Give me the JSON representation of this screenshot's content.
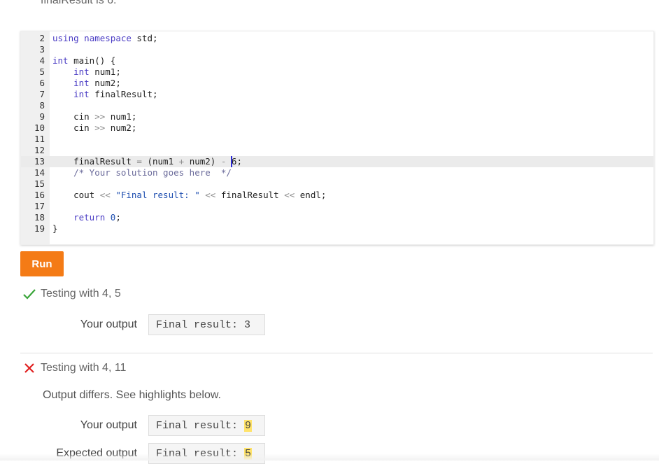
{
  "top_cut_text": "finalResult is 6.",
  "editor": {
    "lines": [
      {
        "n": "2",
        "parts": [
          [
            "kw",
            "using"
          ],
          [
            "t",
            " "
          ],
          [
            "kw",
            "namespace"
          ],
          [
            "t",
            " std;"
          ]
        ]
      },
      {
        "n": "3",
        "parts": []
      },
      {
        "n": "4",
        "parts": [
          [
            "kw",
            "int"
          ],
          [
            "t",
            " main() {"
          ]
        ]
      },
      {
        "n": "5",
        "parts": [
          [
            "t",
            "    "
          ],
          [
            "kw",
            "int"
          ],
          [
            "t",
            " num1;"
          ]
        ]
      },
      {
        "n": "6",
        "parts": [
          [
            "t",
            "    "
          ],
          [
            "kw",
            "int"
          ],
          [
            "t",
            " num2;"
          ]
        ]
      },
      {
        "n": "7",
        "parts": [
          [
            "t",
            "    "
          ],
          [
            "kw",
            "int"
          ],
          [
            "t",
            " finalResult;"
          ]
        ]
      },
      {
        "n": "8",
        "parts": []
      },
      {
        "n": "9",
        "parts": [
          [
            "t",
            "    cin "
          ],
          [
            "op",
            ">>"
          ],
          [
            "t",
            " num1;"
          ]
        ]
      },
      {
        "n": "10",
        "parts": [
          [
            "t",
            "    cin "
          ],
          [
            "op",
            ">>"
          ],
          [
            "t",
            " num2;"
          ]
        ]
      },
      {
        "n": "11",
        "parts": []
      },
      {
        "n": "12",
        "parts": []
      },
      {
        "n": "13",
        "active": true,
        "parts": [
          [
            "t",
            "    finalResult "
          ],
          [
            "op",
            "="
          ],
          [
            "t",
            " (num1 "
          ],
          [
            "op",
            "+"
          ],
          [
            "t",
            " num2) "
          ],
          [
            "op",
            "-"
          ],
          [
            "t",
            " "
          ],
          [
            "cur",
            "6"
          ],
          [
            "t",
            ";"
          ]
        ]
      },
      {
        "n": "14",
        "parts": [
          [
            "t",
            "    "
          ],
          [
            "cmt",
            "/* Your solution goes here  */"
          ]
        ]
      },
      {
        "n": "15",
        "parts": []
      },
      {
        "n": "16",
        "parts": [
          [
            "t",
            "    cout "
          ],
          [
            "op",
            "<<"
          ],
          [
            "t",
            " "
          ],
          [
            "str",
            "\"Final result: \""
          ],
          [
            "t",
            " "
          ],
          [
            "op",
            "<<"
          ],
          [
            "t",
            " finalResult "
          ],
          [
            "op",
            "<<"
          ],
          [
            "t",
            " endl;"
          ]
        ]
      },
      {
        "n": "17",
        "parts": []
      },
      {
        "n": "18",
        "parts": [
          [
            "t",
            "    "
          ],
          [
            "kw",
            "return"
          ],
          [
            "t",
            " "
          ],
          [
            "num",
            "0"
          ],
          [
            "t",
            ";"
          ]
        ]
      },
      {
        "n": "19",
        "parts": [
          [
            "t",
            "}"
          ]
        ]
      }
    ]
  },
  "run_button": {
    "label": "Run"
  },
  "tests": [
    {
      "status": "pass",
      "title": "Testing with 4, 5",
      "your_output_label": "Your output",
      "your_output_prefix": "Final result: ",
      "your_output_value": "3"
    },
    {
      "status": "fail",
      "title": "Testing with 4, 11",
      "note": "Output differs. See highlights below.",
      "your_output_label": "Your output",
      "your_output_prefix": "Final result: ",
      "your_output_value": "9",
      "expected_output_label": "Expected output",
      "expected_output_prefix": "Final result: ",
      "expected_output_value": "5"
    }
  ],
  "colors": {
    "run_button": "#f47b16",
    "pass": "#3aa53a",
    "fail": "#e02020",
    "highlight": "#ffe36b"
  }
}
